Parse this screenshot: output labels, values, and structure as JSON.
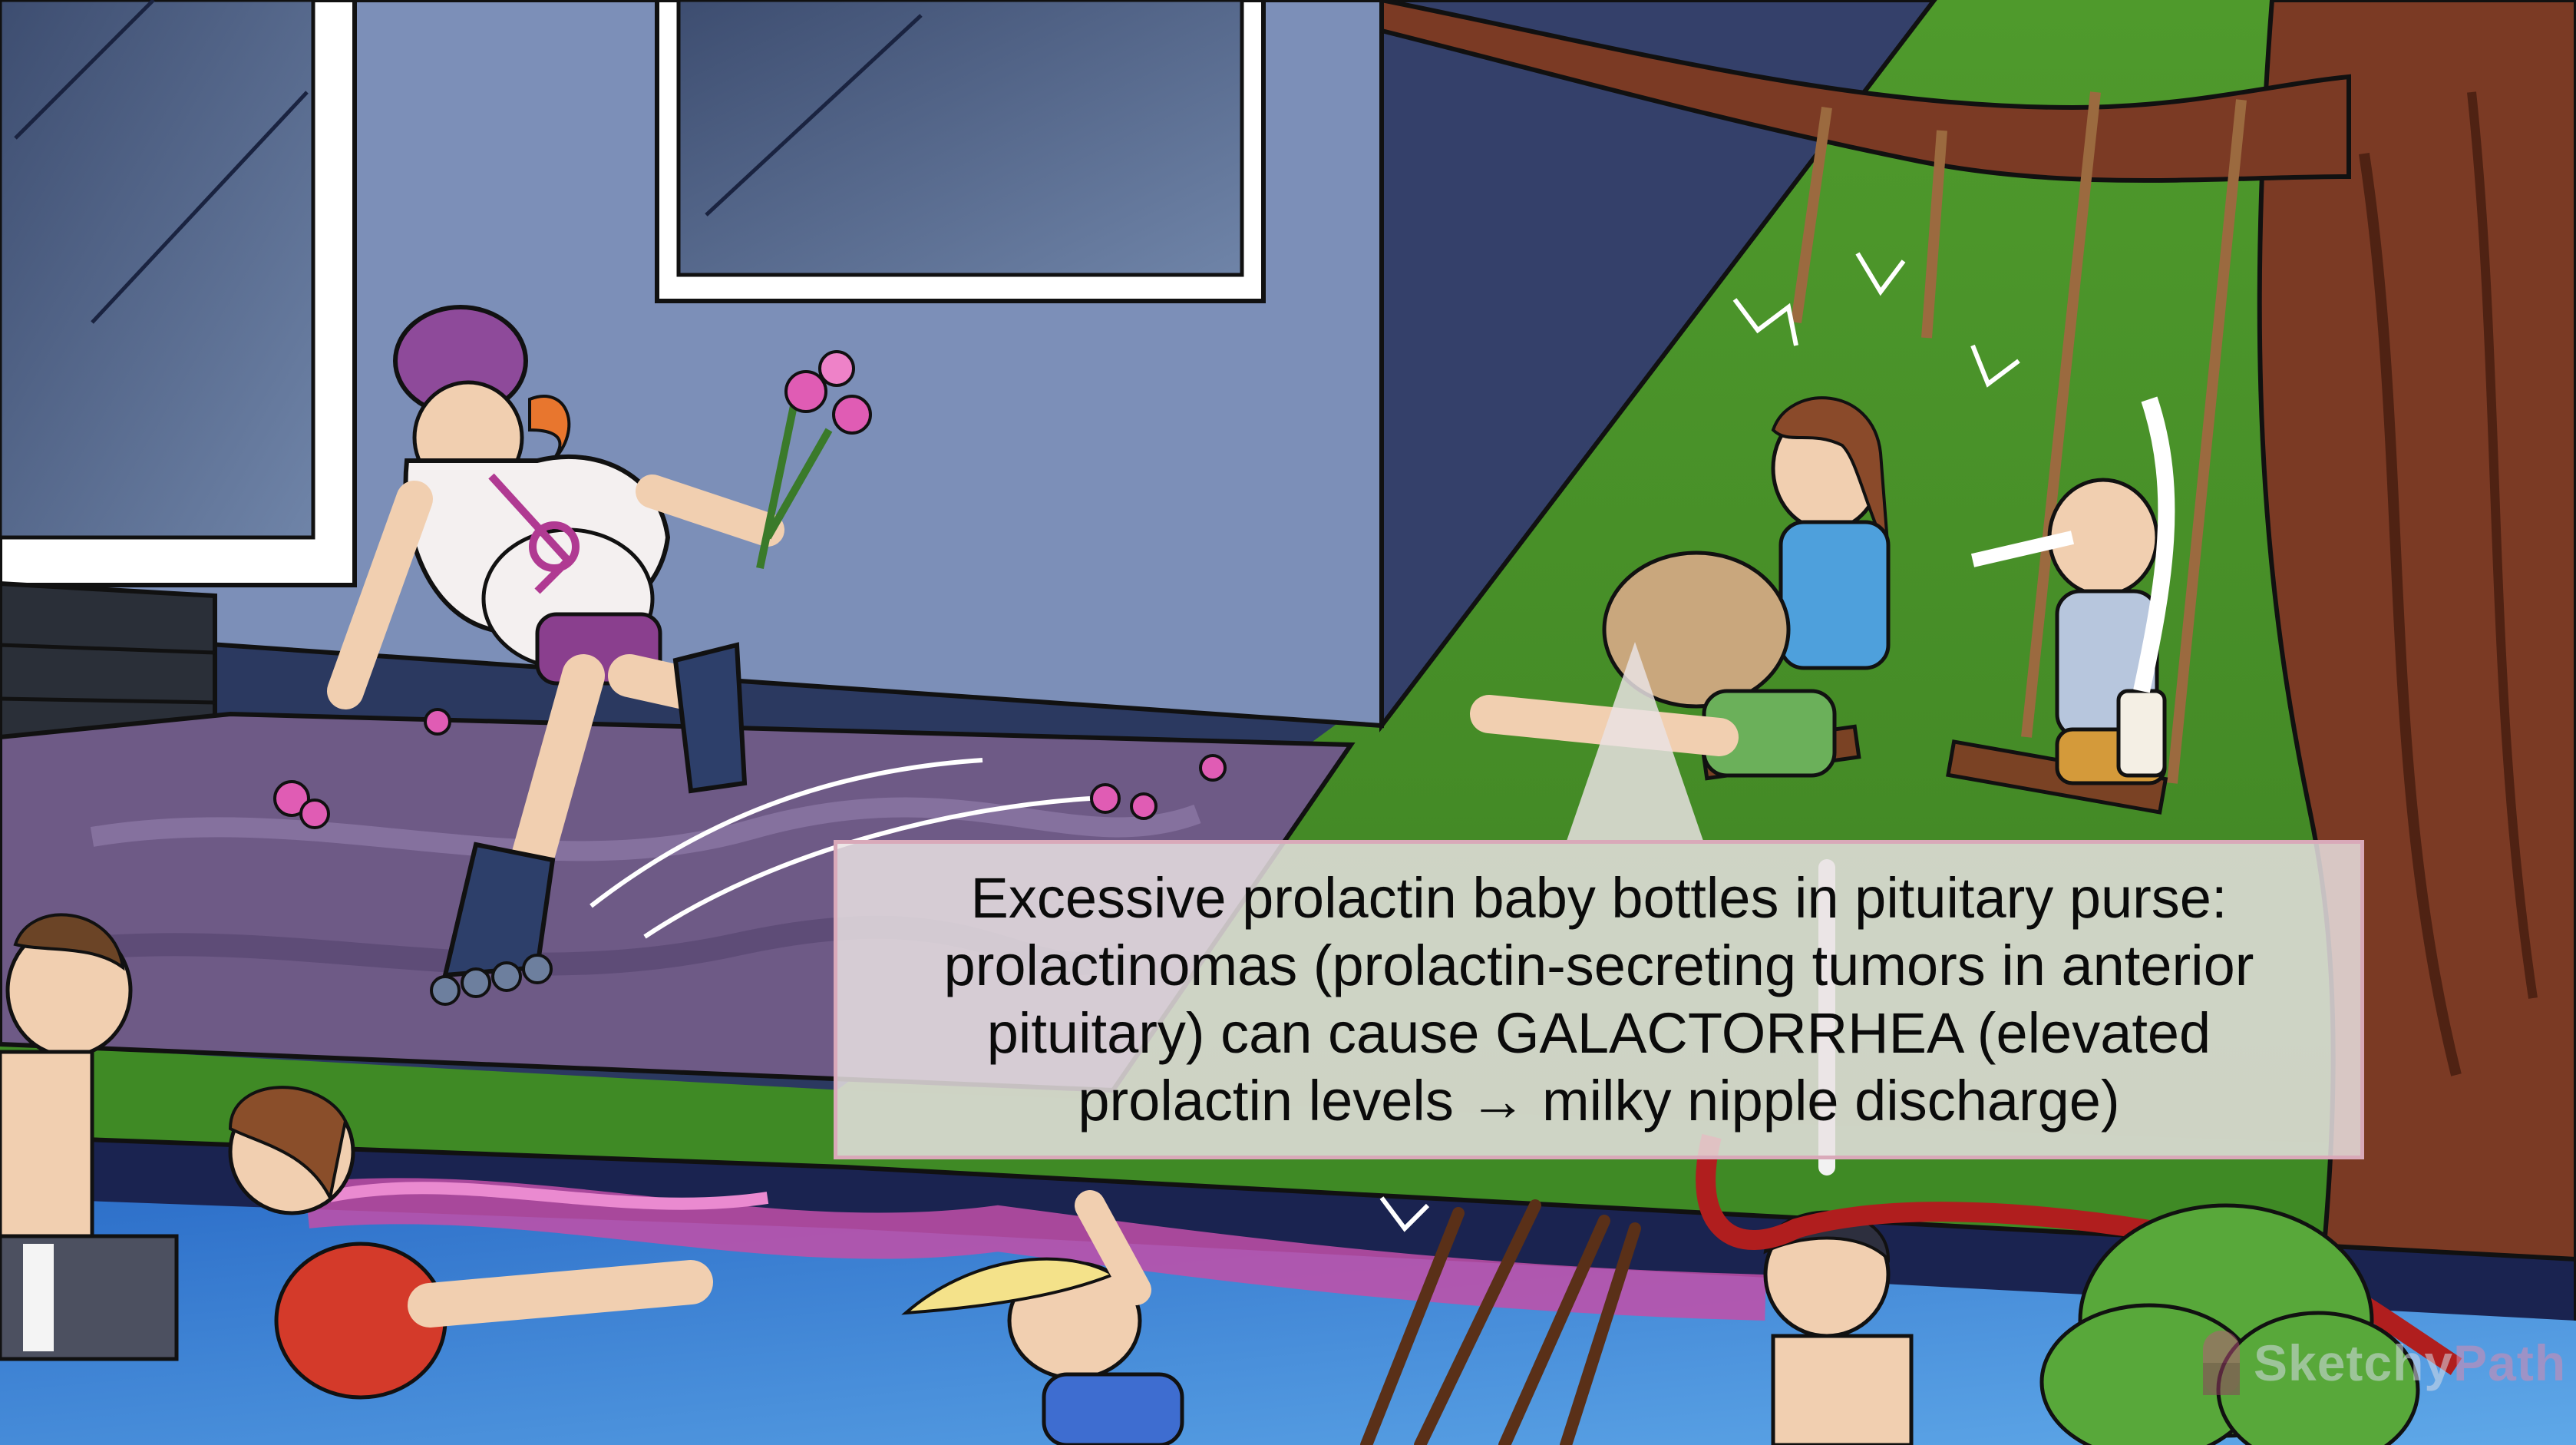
{
  "callout": {
    "text": "Excessive prolactin baby bottles in pituitary purse:\nprolactinomas (prolactin-secreting tumors in anterior\npituitary) can cause GALACTORRHEA (elevated\nprolactin levels → milky nipple discharge)"
  },
  "logo": {
    "part1": "Sketchy",
    "part2": "Path"
  }
}
